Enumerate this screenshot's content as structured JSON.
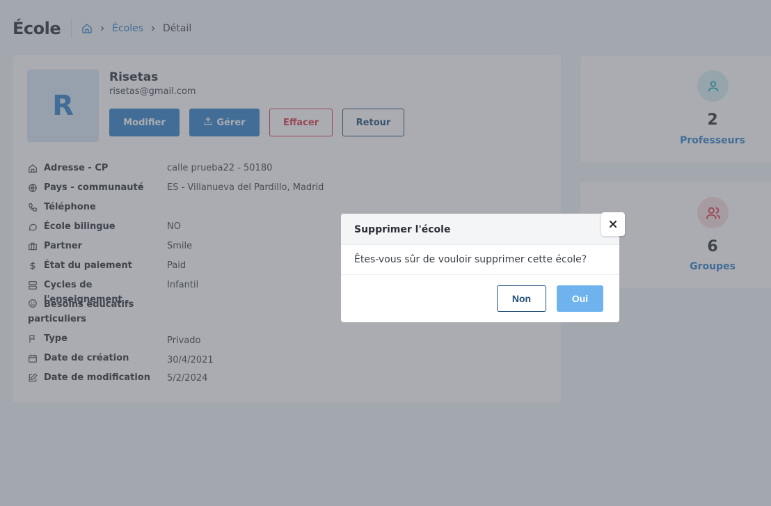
{
  "header": {
    "title": "École",
    "breadcrumb": {
      "home_icon": "home-icon",
      "items": [
        {
          "label": "Écoles"
        },
        {
          "label": "Détail"
        }
      ]
    }
  },
  "school": {
    "avatar_letter": "R",
    "name": "Risetas",
    "email": "risetas@gmail.com",
    "buttons": {
      "modify": "Modifier",
      "manage": "Gérer",
      "delete": "Effacer",
      "back": "Retour"
    },
    "details": [
      {
        "icon": "home-icon",
        "label": "Adresse - CP",
        "value": "calle prueba22 - 50180"
      },
      {
        "icon": "globe-icon",
        "label": "Pays - communauté",
        "value": "ES - Villanueva del Pardillo, Madrid"
      },
      {
        "icon": "phone-icon",
        "label": "Téléphone",
        "value": ""
      },
      {
        "icon": "chat-icon",
        "label": "École bilingue",
        "value": "NO"
      },
      {
        "icon": "briefcase-icon",
        "label": "Partner",
        "value": "Smile"
      },
      {
        "icon": "dollar-icon",
        "label": "État du paiement",
        "value": "Paid"
      },
      {
        "icon": "server-icon",
        "label": "Cycles de l'enseignement",
        "value": "Infantil"
      },
      {
        "icon": "smile-icon",
        "label": "Besoins éducatifs particuliers",
        "value": ""
      },
      {
        "icon": "flag-icon",
        "label": "Type",
        "value": "Privado"
      },
      {
        "icon": "calendar-icon",
        "label": "Date de création",
        "value": "30/4/2021"
      },
      {
        "icon": "edit-icon",
        "label": "Date de modification",
        "value": "5/2/2024"
      }
    ]
  },
  "stats": {
    "professors": {
      "count": "2",
      "label": "Professeurs",
      "icon": "user-icon"
    },
    "groups": {
      "count": "6",
      "label": "Groupes",
      "icon": "users-icon"
    }
  },
  "modal": {
    "title": "Supprimer l'école",
    "message": "Êtes-vous sûr de vouloir supprimer cette école?",
    "no_label": "Non",
    "yes_label": "Oui",
    "close_icon": "close-icon"
  },
  "colors": {
    "primary": "#2f80c9",
    "danger": "#dc3545",
    "dark_blue": "#1f4e79",
    "yes_button": "#6fb3ee"
  }
}
